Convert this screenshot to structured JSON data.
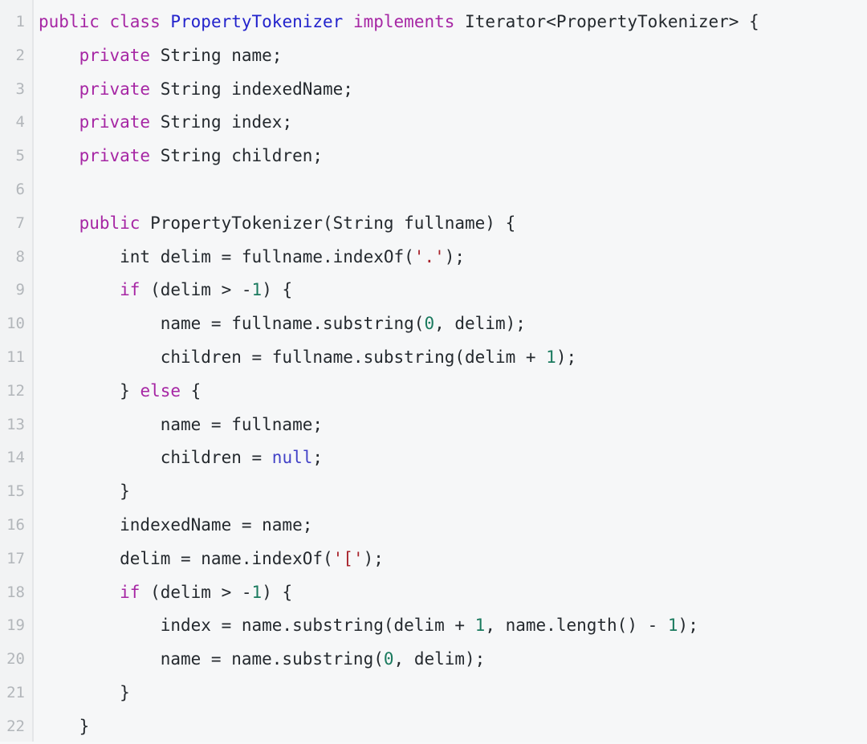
{
  "editor": {
    "language": "java",
    "background_color": "#f6f7f8",
    "gutter_color": "#f2f3f4",
    "line_number_color": "#b2b6ba",
    "first_line": 1,
    "last_line": 22,
    "total_lines": 22
  },
  "palette": {
    "plain": "#24292e",
    "keyword": "#a626a4",
    "type": "#2323cc",
    "string": "#a8232b",
    "number": "#1a7a5e",
    "constant": "#4242c7"
  },
  "lines": [
    {
      "number": "1",
      "text": "public class PropertyTokenizer implements Iterator<PropertyTokenizer> {",
      "tokens": [
        {
          "t": "public class ",
          "c": "keyword"
        },
        {
          "t": "PropertyTokenizer",
          "c": "type"
        },
        {
          "t": " ",
          "c": "plain"
        },
        {
          "t": "implements",
          "c": "keyword"
        },
        {
          "t": " Iterator<PropertyTokenizer> {",
          "c": "plain"
        }
      ]
    },
    {
      "number": "2",
      "text": "    private String name;",
      "tokens": [
        {
          "t": "    ",
          "c": "plain"
        },
        {
          "t": "private",
          "c": "keyword"
        },
        {
          "t": " String name;",
          "c": "plain"
        }
      ]
    },
    {
      "number": "3",
      "text": "    private String indexedName;",
      "tokens": [
        {
          "t": "    ",
          "c": "plain"
        },
        {
          "t": "private",
          "c": "keyword"
        },
        {
          "t": " String indexedName;",
          "c": "plain"
        }
      ]
    },
    {
      "number": "4",
      "text": "    private String index;",
      "tokens": [
        {
          "t": "    ",
          "c": "plain"
        },
        {
          "t": "private",
          "c": "keyword"
        },
        {
          "t": " String index;",
          "c": "plain"
        }
      ]
    },
    {
      "number": "5",
      "text": "    private String children;",
      "tokens": [
        {
          "t": "    ",
          "c": "plain"
        },
        {
          "t": "private",
          "c": "keyword"
        },
        {
          "t": " String children;",
          "c": "plain"
        }
      ]
    },
    {
      "number": "6",
      "text": "",
      "tokens": []
    },
    {
      "number": "7",
      "text": "    public PropertyTokenizer(String fullname) {",
      "tokens": [
        {
          "t": "    ",
          "c": "plain"
        },
        {
          "t": "public",
          "c": "keyword"
        },
        {
          "t": " PropertyTokenizer(String fullname) {",
          "c": "plain"
        }
      ]
    },
    {
      "number": "8",
      "text": "        int delim = fullname.indexOf('.');",
      "tokens": [
        {
          "t": "        int delim = fullname.indexOf(",
          "c": "plain"
        },
        {
          "t": "'.'",
          "c": "string"
        },
        {
          "t": ");",
          "c": "plain"
        }
      ]
    },
    {
      "number": "9",
      "text": "        if (delim > -1) {",
      "tokens": [
        {
          "t": "        ",
          "c": "plain"
        },
        {
          "t": "if",
          "c": "keyword"
        },
        {
          "t": " (delim > -",
          "c": "plain"
        },
        {
          "t": "1",
          "c": "number"
        },
        {
          "t": ") {",
          "c": "plain"
        }
      ]
    },
    {
      "number": "10",
      "text": "            name = fullname.substring(0, delim);",
      "tokens": [
        {
          "t": "            name = fullname.substring(",
          "c": "plain"
        },
        {
          "t": "0",
          "c": "number"
        },
        {
          "t": ", delim);",
          "c": "plain"
        }
      ]
    },
    {
      "number": "11",
      "text": "            children = fullname.substring(delim + 1);",
      "tokens": [
        {
          "t": "            children = fullname.substring(delim + ",
          "c": "plain"
        },
        {
          "t": "1",
          "c": "number"
        },
        {
          "t": ");",
          "c": "plain"
        }
      ]
    },
    {
      "number": "12",
      "text": "        } else {",
      "tokens": [
        {
          "t": "        } ",
          "c": "plain"
        },
        {
          "t": "else",
          "c": "keyword"
        },
        {
          "t": " {",
          "c": "plain"
        }
      ]
    },
    {
      "number": "13",
      "text": "            name = fullname;",
      "tokens": [
        {
          "t": "            name = fullname;",
          "c": "plain"
        }
      ]
    },
    {
      "number": "14",
      "text": "            children = null;",
      "tokens": [
        {
          "t": "            children = ",
          "c": "plain"
        },
        {
          "t": "null",
          "c": "constant"
        },
        {
          "t": ";",
          "c": "plain"
        }
      ]
    },
    {
      "number": "15",
      "text": "        }",
      "tokens": [
        {
          "t": "        }",
          "c": "plain"
        }
      ]
    },
    {
      "number": "16",
      "text": "        indexedName = name;",
      "tokens": [
        {
          "t": "        indexedName = name;",
          "c": "plain"
        }
      ]
    },
    {
      "number": "17",
      "text": "        delim = name.indexOf('[');",
      "tokens": [
        {
          "t": "        delim = name.indexOf(",
          "c": "plain"
        },
        {
          "t": "'['",
          "c": "string"
        },
        {
          "t": ");",
          "c": "plain"
        }
      ]
    },
    {
      "number": "18",
      "text": "        if (delim > -1) {",
      "tokens": [
        {
          "t": "        ",
          "c": "plain"
        },
        {
          "t": "if",
          "c": "keyword"
        },
        {
          "t": " (delim > -",
          "c": "plain"
        },
        {
          "t": "1",
          "c": "number"
        },
        {
          "t": ") {",
          "c": "plain"
        }
      ]
    },
    {
      "number": "19",
      "text": "            index = name.substring(delim + 1, name.length() - 1);",
      "tokens": [
        {
          "t": "            index = name.substring(delim + ",
          "c": "plain"
        },
        {
          "t": "1",
          "c": "number"
        },
        {
          "t": ", name.length() - ",
          "c": "plain"
        },
        {
          "t": "1",
          "c": "number"
        },
        {
          "t": ");",
          "c": "plain"
        }
      ]
    },
    {
      "number": "20",
      "text": "            name = name.substring(0, delim);",
      "tokens": [
        {
          "t": "            name = name.substring(",
          "c": "plain"
        },
        {
          "t": "0",
          "c": "number"
        },
        {
          "t": ", delim);",
          "c": "plain"
        }
      ]
    },
    {
      "number": "21",
      "text": "        }",
      "tokens": [
        {
          "t": "        }",
          "c": "plain"
        }
      ]
    },
    {
      "number": "22",
      "text": "    }",
      "tokens": [
        {
          "t": "    }",
          "c": "plain"
        }
      ]
    }
  ]
}
